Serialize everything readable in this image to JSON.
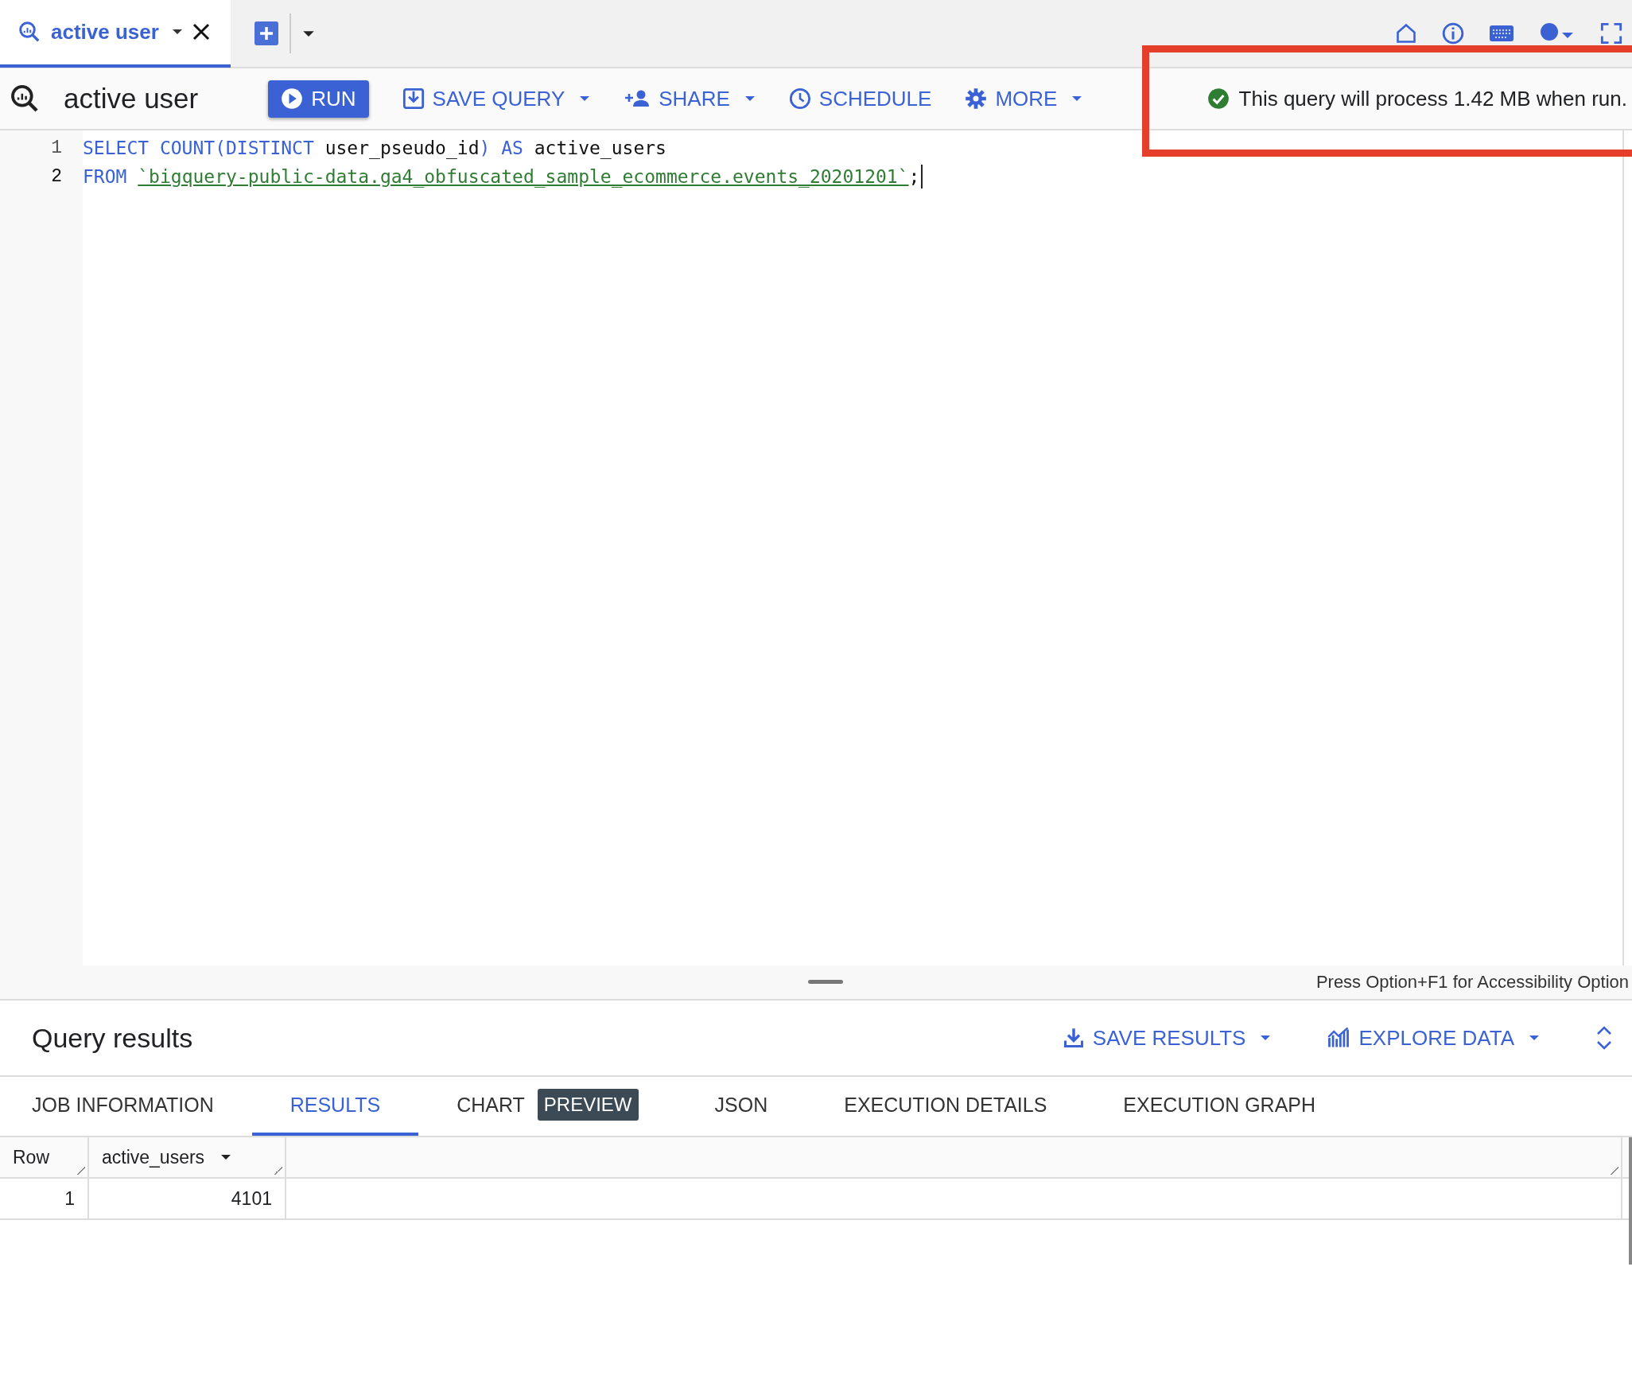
{
  "tab_bar": {
    "tabs": [
      {
        "label": "active user",
        "selected": true
      }
    ]
  },
  "query": {
    "title": "active user",
    "buttons": [
      {
        "label": "RUN",
        "kind": "primary",
        "dropdown": false
      },
      {
        "label": "SAVE QUERY",
        "kind": "text",
        "dropdown": true
      },
      {
        "label": "SHARE",
        "kind": "text",
        "dropdown": true
      },
      {
        "label": "SCHEDULE",
        "kind": "text",
        "dropdown": false
      },
      {
        "label": "MORE",
        "kind": "text",
        "dropdown": true
      }
    ],
    "status": "This query will process 1.42 MB when run."
  },
  "editor": {
    "lines": [
      {
        "number": "1",
        "tokens": [
          {
            "text": "SELECT COUNT(DISTINCT",
            "kind": "keyword"
          },
          {
            "text": " user_pseudo_id",
            "kind": "plain"
          },
          {
            "text": ")",
            "kind": "keyword"
          },
          {
            "text": " AS",
            "kind": "keyword"
          },
          {
            "text": " active_users",
            "kind": "plain"
          }
        ]
      },
      {
        "number": "2",
        "tokens": [
          {
            "text": "FROM ",
            "kind": "keyword"
          },
          {
            "text": "`bigquery-public-data.ga4_obfuscated_sample_ecommerce.events_20201201`",
            "kind": "string"
          },
          {
            "text": ";",
            "kind": "plain"
          }
        ]
      }
    ],
    "accessibility_hint": "Press Option+F1 for Accessibility Option"
  },
  "results": {
    "title": "Query results",
    "actions": [
      {
        "label": "SAVE RESULTS"
      },
      {
        "label": "EXPLORE DATA"
      }
    ],
    "tabs": [
      {
        "label": "JOB INFORMATION",
        "selected": false
      },
      {
        "label": "RESULTS",
        "selected": true
      },
      {
        "label": "CHART",
        "badge": "PREVIEW",
        "selected": false
      },
      {
        "label": "JSON",
        "selected": false
      },
      {
        "label": "EXECUTION DETAILS",
        "selected": false
      },
      {
        "label": "EXECUTION GRAPH",
        "selected": false
      }
    ],
    "table": {
      "columns": [
        "Row",
        "active_users"
      ],
      "rows": [
        [
          "1",
          "4101"
        ]
      ]
    }
  }
}
